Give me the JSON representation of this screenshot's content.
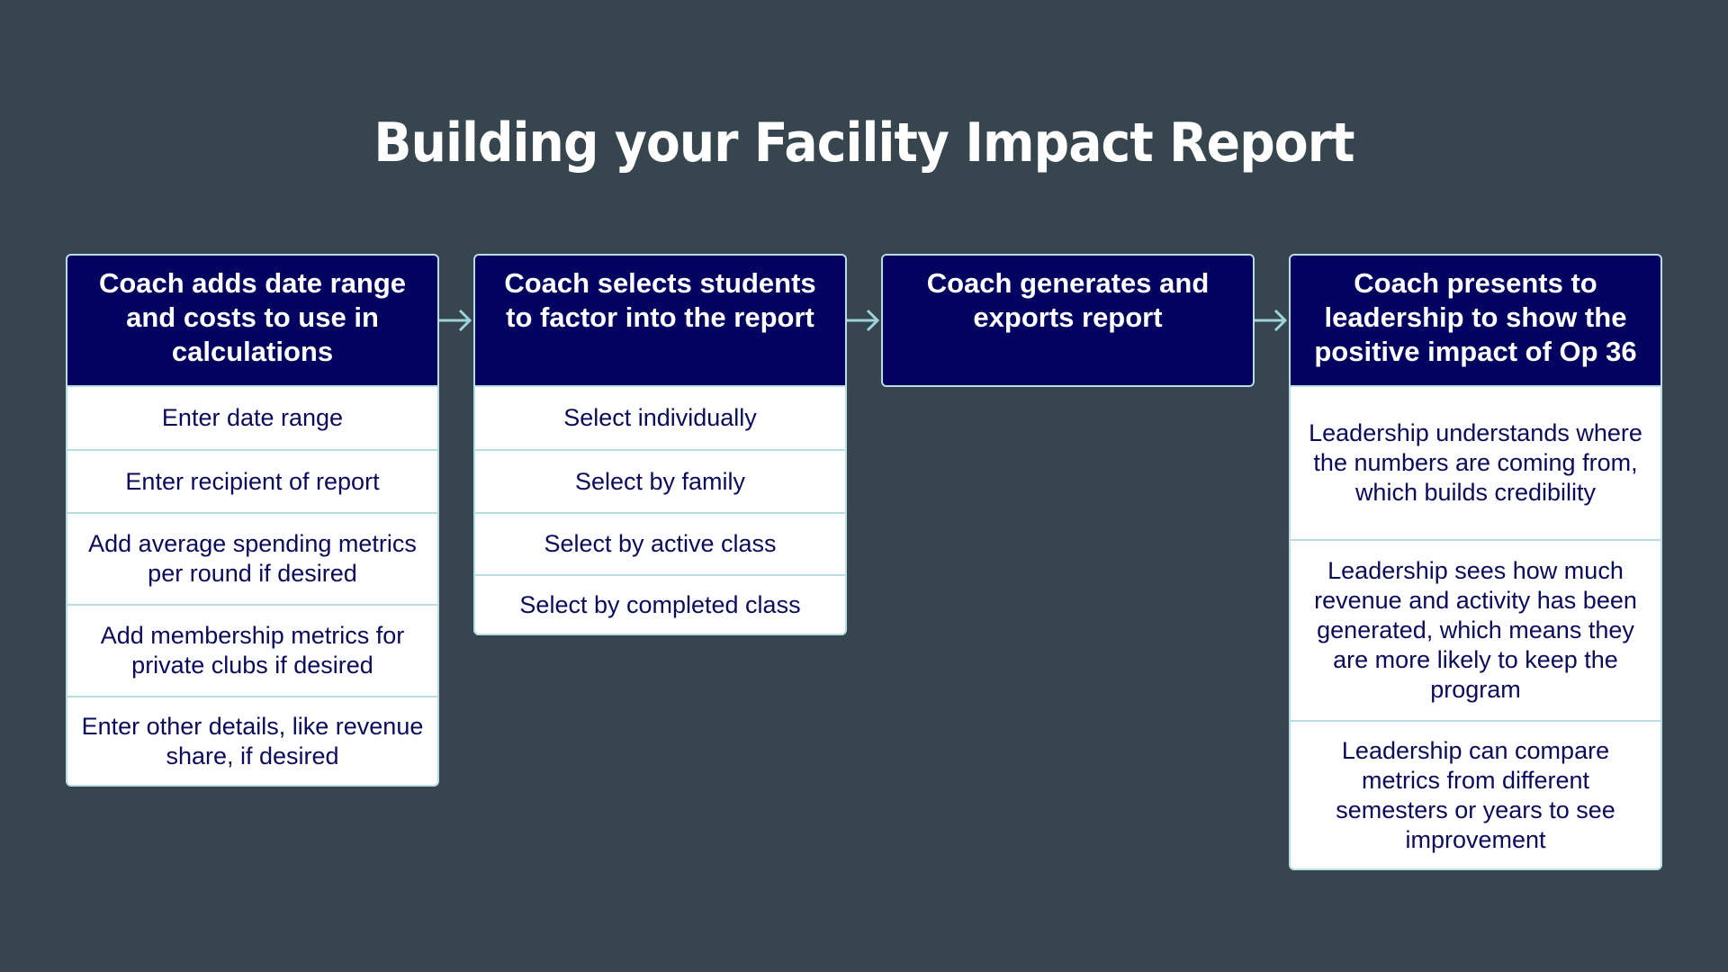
{
  "title": "Building your Facility Impact Report",
  "colors": {
    "background": "#37454f",
    "header": "#020360",
    "border": "#b9dde3",
    "item_text": "#0b0b5c"
  },
  "steps": [
    {
      "heading": "Coach adds date range and costs to use in calculations",
      "items": [
        "Enter date range",
        "Enter recipient of report",
        "Add average spending metrics per round if desired",
        "Add membership metrics for private clubs if desired",
        "Enter other details, like revenue share, if desired"
      ]
    },
    {
      "heading": "Coach selects students to factor into the report",
      "items": [
        "Select individually",
        "Select by family",
        "Select by active class",
        "Select by completed class"
      ]
    },
    {
      "heading": "Coach generates and exports report",
      "items": []
    },
    {
      "heading": "Coach presents to leadership to show the positive impact of Op 36",
      "items": [
        "Leadership understands where the numbers are coming from, which builds credibility",
        "Leadership sees how much revenue and activity has been generated, which means they are more likely to keep the program",
        "Leadership can compare metrics from different semesters or years to see improvement"
      ]
    }
  ],
  "connectors": [
    {
      "from": 1,
      "to": 2,
      "icon": "arrow-right-icon"
    },
    {
      "from": 2,
      "to": 3,
      "icon": "arrow-right-icon"
    },
    {
      "from": 3,
      "to": 4,
      "icon": "arrow-right-icon"
    }
  ]
}
